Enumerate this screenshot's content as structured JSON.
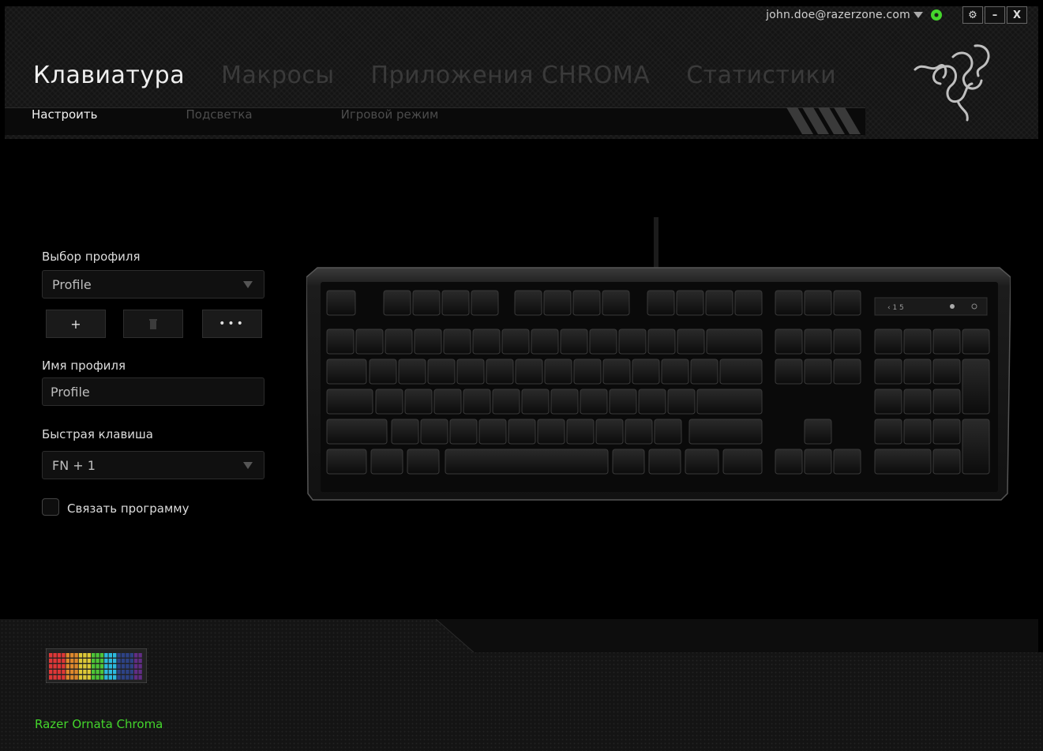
{
  "account": {
    "email": "john.doe@razerzone.com"
  },
  "window_controls": {
    "settings": "⚙",
    "minimize": "–",
    "close": "X"
  },
  "tabs": [
    {
      "label": "Клавиатура",
      "active": true
    },
    {
      "label": "Макросы",
      "active": false
    },
    {
      "label": "Приложения CHROMA",
      "active": false
    },
    {
      "label": "Статистики",
      "active": false
    }
  ],
  "subtabs": [
    {
      "label": "Настроить",
      "active": true
    },
    {
      "label": "Подсветка",
      "active": false
    },
    {
      "label": "Игровой режим",
      "active": false
    }
  ],
  "profile": {
    "select_label": "Выбор профиля",
    "selected": "Profile",
    "add_label": "+",
    "more_label": "•••",
    "name_label": "Имя профиля",
    "name_value": "Profile",
    "hotkey_label": "Быстрая клавиша",
    "hotkey_value": "FN + 1",
    "link_program_label": "Связать программу",
    "link_program_checked": false
  },
  "device": {
    "name": "Razer Ornata Chroma"
  },
  "colors": {
    "accent": "#44d62c",
    "background": "#000000"
  }
}
